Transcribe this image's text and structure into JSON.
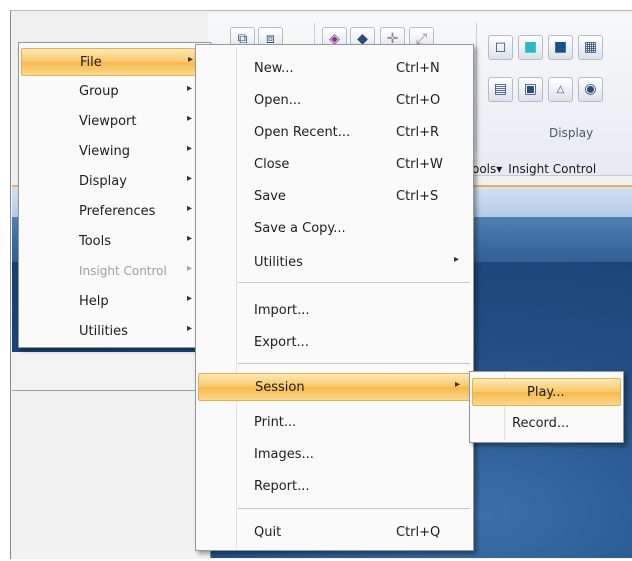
{
  "left_menu": {
    "items": [
      {
        "label": "File",
        "arrow": "▸",
        "state": "highlighted"
      },
      {
        "label": "Group",
        "arrow": "▸",
        "state": "normal"
      },
      {
        "label": "Viewport",
        "arrow": "▸",
        "state": "normal"
      },
      {
        "label": "Viewing",
        "arrow": "▸",
        "state": "normal"
      },
      {
        "label": "Display",
        "arrow": "▸",
        "state": "normal"
      },
      {
        "label": "Preferences",
        "arrow": "▸",
        "state": "normal"
      },
      {
        "label": "Tools",
        "arrow": "▸",
        "state": "normal"
      },
      {
        "label": "Insight Control",
        "arrow": "▸",
        "state": "disabled"
      },
      {
        "label": "Help",
        "arrow": "▸",
        "state": "normal"
      },
      {
        "label": "Utilities",
        "arrow": "▸",
        "state": "normal"
      }
    ]
  },
  "file_menu": {
    "items": [
      {
        "label": "New...",
        "shortcut": "Ctrl+N"
      },
      {
        "label": "Open...",
        "shortcut": "Ctrl+O"
      },
      {
        "label": "Open Recent...",
        "shortcut": "Ctrl+R"
      },
      {
        "label": "Close",
        "shortcut": "Ctrl+W"
      },
      {
        "label": "Save",
        "shortcut": "Ctrl+S"
      },
      {
        "label": "Save a Copy...",
        "shortcut": ""
      },
      {
        "label": "Utilities",
        "arrow": "▸"
      },
      {
        "label": "Import...",
        "shortcut": ""
      },
      {
        "label": "Export...",
        "shortcut": ""
      },
      {
        "label": "Session",
        "arrow": "▸",
        "state": "highlighted"
      },
      {
        "label": "Print...",
        "shortcut": ""
      },
      {
        "label": "Images...",
        "shortcut": ""
      },
      {
        "label": "Report...",
        "shortcut": ""
      },
      {
        "label": "Quit",
        "shortcut": "Ctrl+Q"
      }
    ]
  },
  "session_menu": {
    "items": [
      {
        "label": "Play...",
        "state": "highlighted"
      },
      {
        "label": "Record...",
        "state": "normal"
      }
    ]
  },
  "ribbon": {
    "group_label": "Display",
    "tabs": [
      "ools▾",
      "Insight Control"
    ],
    "icons": [
      "view-front-icon",
      "view-back-icon",
      "shaded-cube-icon",
      "render-icon",
      "axis-icon",
      "zoom-icon",
      "wireframe-cube-icon",
      "cyan-cube-icon",
      "solid-cube-icon",
      "grid-icon",
      "layout-icon",
      "tile-icon",
      "triangle-icon",
      "sphere-icon"
    ]
  },
  "colors": {
    "highlight": "#f9c766",
    "viewport": "#214f86",
    "menu_bg": "#fafafa"
  }
}
